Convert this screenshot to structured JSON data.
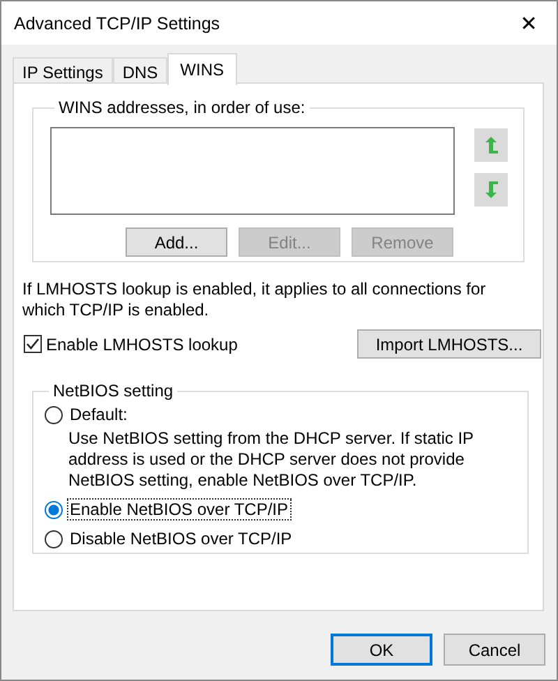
{
  "window": {
    "title": "Advanced TCP/IP Settings",
    "close": "✕"
  },
  "tabs": [
    {
      "label": "IP Settings",
      "selected": false
    },
    {
      "label": "DNS",
      "selected": false
    },
    {
      "label": "WINS",
      "selected": true
    }
  ],
  "wins": {
    "label": "WINS addresses, in order of use:",
    "buttons": [
      {
        "label": "Add...",
        "disabled": false
      },
      {
        "label": "Edit...",
        "disabled": true
      },
      {
        "label": "Remove",
        "disabled": true
      }
    ]
  },
  "lmhosts_note": "If LMHOSTS lookup is enabled, it applies to all connections for which TCP/IP is enabled.",
  "lmhosts_checkbox": {
    "label": "Enable LMHOSTS lookup",
    "checked": true
  },
  "import_button": "Import LMHOSTS...",
  "netbios": {
    "label": "NetBIOS setting",
    "options": [
      {
        "label": "Default:",
        "selected": false,
        "description": "Use NetBIOS setting from the DHCP server. If static IP address is used or the DHCP server does not provide NetBIOS setting, enable NetBIOS over TCP/IP."
      },
      {
        "label": "Enable NetBIOS over TCP/IP",
        "selected": true
      },
      {
        "label": "Disable NetBIOS over TCP/IP",
        "selected": false
      }
    ]
  },
  "buttons": [
    "OK",
    "Cancel"
  ]
}
